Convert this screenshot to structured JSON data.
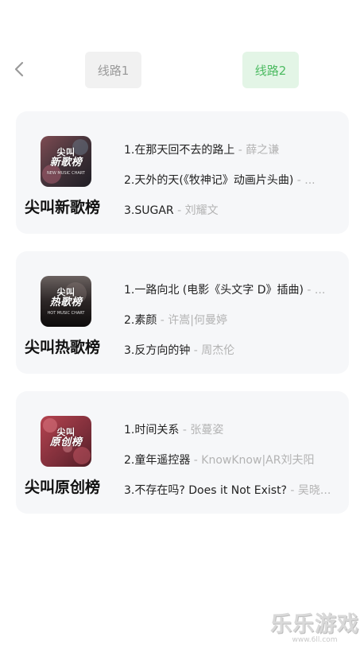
{
  "header": {
    "back_icon": "chevron-left-icon",
    "tabs": [
      {
        "label": "线路1",
        "active": false
      },
      {
        "label": "线路2",
        "active": true
      }
    ],
    "active_color": "#4dbb62"
  },
  "charts": [
    {
      "title": "尖叫新歌榜",
      "cover": {
        "line1": "尖叫",
        "line2": "新歌榜",
        "small": "NEW MUSIC CHART"
      },
      "songs": [
        {
          "index": "1.",
          "name": "在那天回不去的路上",
          "artist": " - 薛之谦"
        },
        {
          "index": "2.",
          "name": "天外的天(《牧神记》动画片头曲)",
          "artist": " - ..."
        },
        {
          "index": "3.",
          "name": "SUGAR",
          "artist": " - 刘耀文"
        }
      ]
    },
    {
      "title": "尖叫热歌榜",
      "cover": {
        "line1": "尖叫",
        "line2": "热歌榜",
        "small": "HOT MUSIC CHART"
      },
      "songs": [
        {
          "index": "1.",
          "name": "一路向北 (电影《头文字 D》插曲)",
          "artist": " - ..."
        },
        {
          "index": "2.",
          "name": "素颜",
          "artist": " - 许嵩|何曼婷"
        },
        {
          "index": "3.",
          "name": "反方向的钟",
          "artist": " - 周杰伦"
        }
      ]
    },
    {
      "title": "尖叫原创榜",
      "cover": {
        "line1": "尖叫",
        "line2": "原创榜",
        "small": ""
      },
      "songs": [
        {
          "index": "1.",
          "name": "时间关系 ",
          "artist": " - 张蔓姿"
        },
        {
          "index": "2.",
          "name": "童年遥控器",
          "artist": " - KnowKnow|AR刘夫阳"
        },
        {
          "index": "3.",
          "name": "不存在吗? Does it Not Exist?",
          "artist": " - 吴晓..."
        }
      ]
    }
  ],
  "watermark": {
    "main": "乐乐游戏",
    "sub": "www.6ll.com"
  }
}
